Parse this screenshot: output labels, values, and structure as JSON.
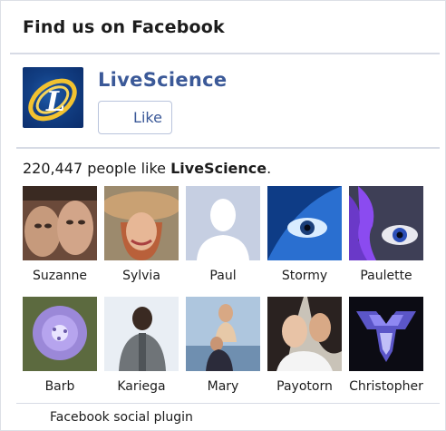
{
  "header": {
    "title": "Find us on Facebook"
  },
  "page": {
    "name": "LiveScience",
    "like_label": "Like",
    "logo_letter": "L"
  },
  "likes": {
    "count": "220,447",
    "text_middle": " people like ",
    "page_name": "LiveScience",
    "suffix": "."
  },
  "faces": [
    {
      "name": "Suzanne",
      "icon": "avatar-photo"
    },
    {
      "name": "Sylvia",
      "icon": "avatar-photo"
    },
    {
      "name": "Paul",
      "icon": "default-avatar-silhouette"
    },
    {
      "name": "Stormy",
      "icon": "avatar-photo"
    },
    {
      "name": "Paulette",
      "icon": "avatar-photo"
    },
    {
      "name": "Barb",
      "icon": "avatar-photo"
    },
    {
      "name": "Kariega",
      "icon": "avatar-photo"
    },
    {
      "name": "Mary",
      "icon": "avatar-photo"
    },
    {
      "name": "Payotorn",
      "icon": "avatar-photo"
    },
    {
      "name": "Christopher",
      "icon": "avatar-photo"
    }
  ],
  "footer": {
    "text": "Facebook social plugin"
  },
  "colors": {
    "brand_blue": "#3b5998",
    "divider": "#d7dbe5"
  }
}
